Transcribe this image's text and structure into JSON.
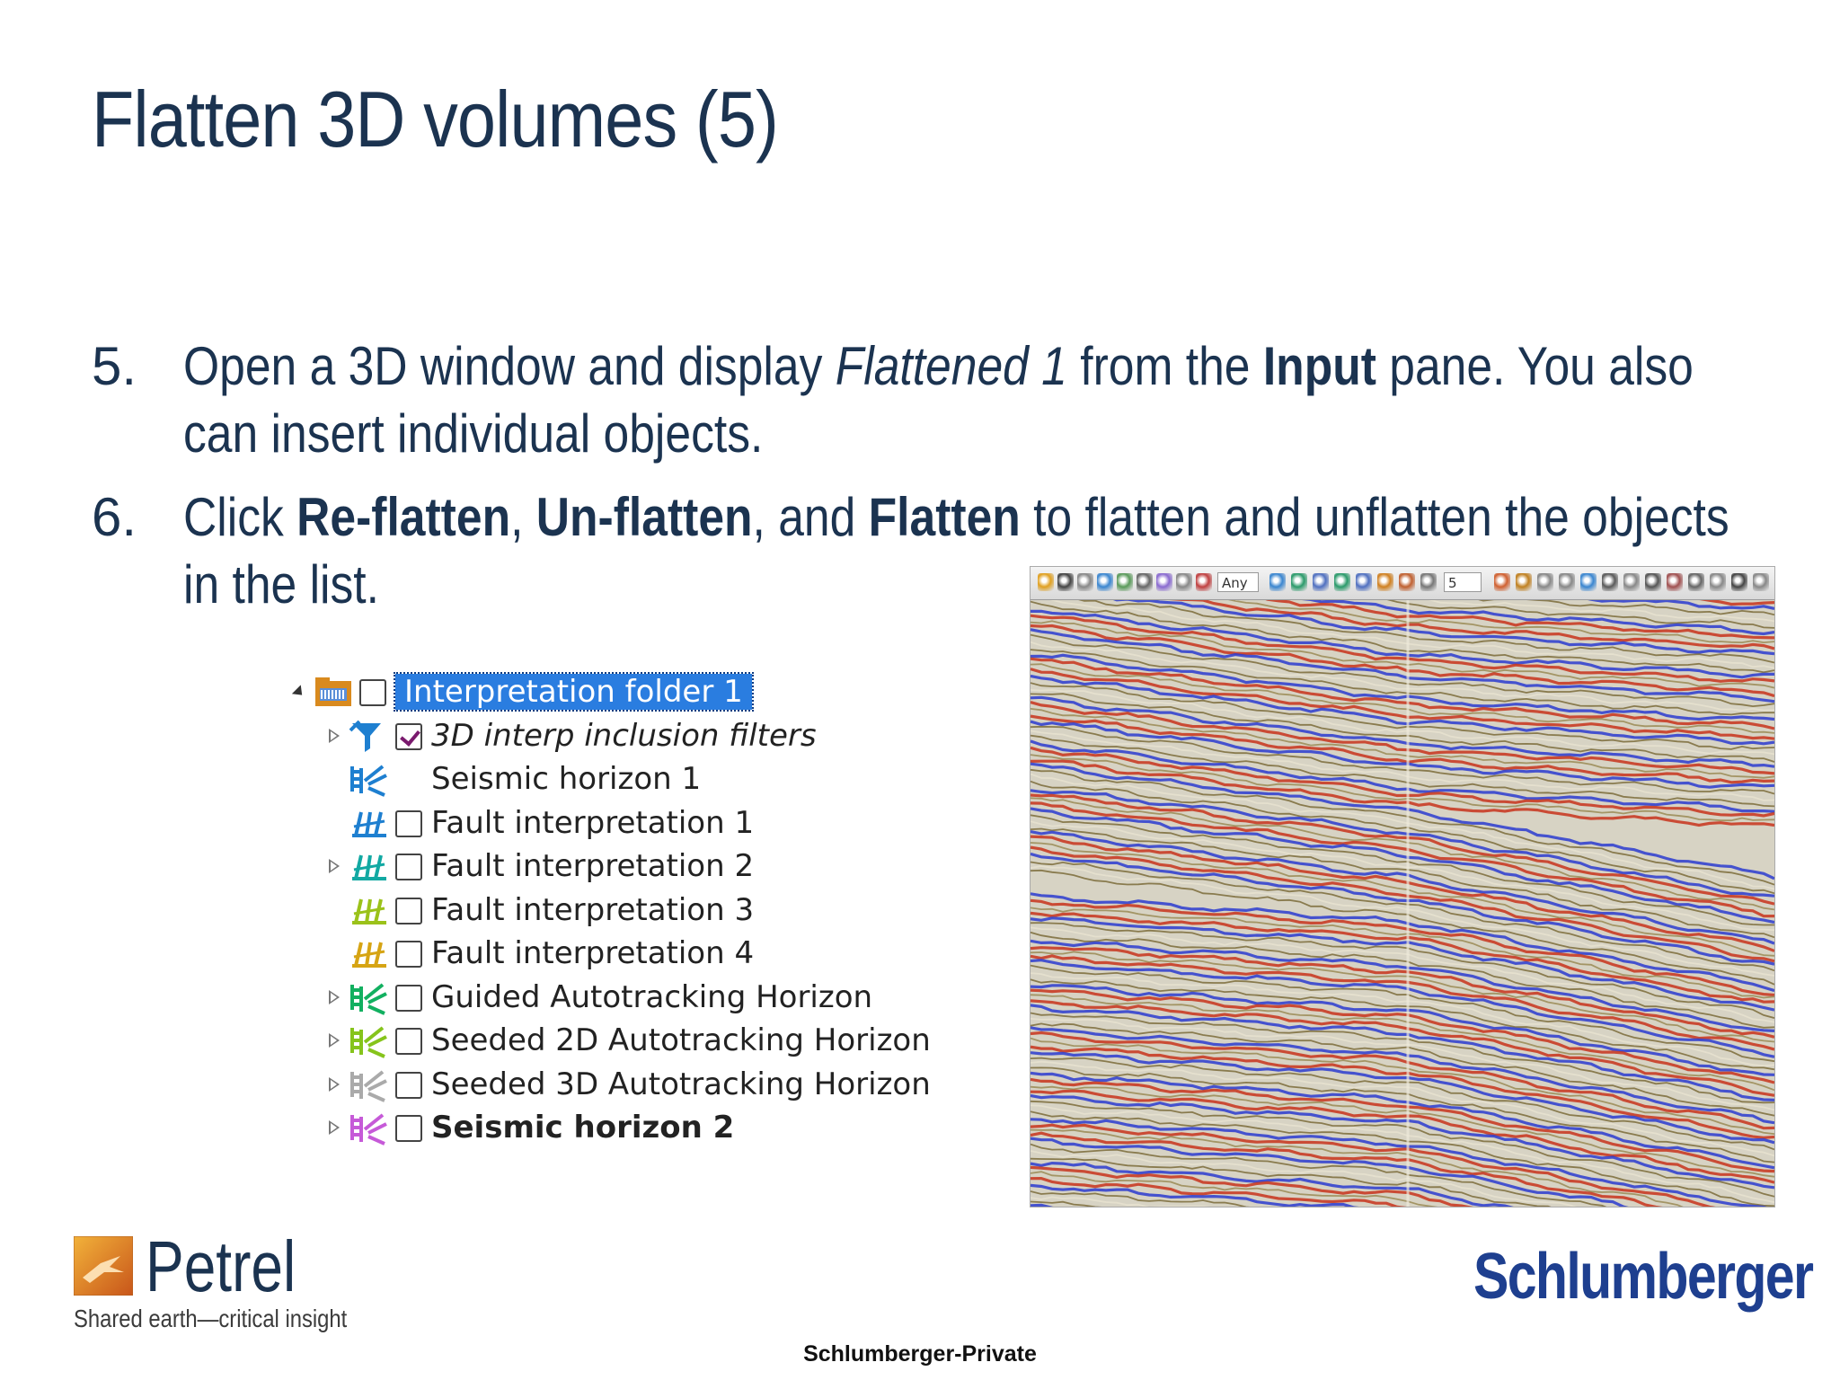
{
  "slide": {
    "title": "Flatten 3D volumes (5)"
  },
  "steps": [
    {
      "number": "5.",
      "parts": [
        "Open a 3D window and display ",
        "Flattened 1",
        " from the ",
        "Input",
        " pane. You also can insert individual objects."
      ]
    },
    {
      "number": "6.",
      "parts": [
        "Click ",
        "Re-flatten",
        ", ",
        "Un-flatten",
        ", and ",
        "Flatten",
        " to flatten and unflatten the objects in the list."
      ]
    }
  ],
  "tree": {
    "items": [
      {
        "label": "Interpretation folder 1",
        "icon": "folder-icon",
        "expander": "expanded",
        "checked": false,
        "selected": true,
        "style": "normal"
      },
      {
        "label": "3D interp inclusion filters",
        "icon": "filter-icon",
        "expander": "collapsed",
        "checked": true,
        "selected": false,
        "style": "italic"
      },
      {
        "label": "Seismic horizon 1",
        "icon": "horizon-icon",
        "expander": "none",
        "checked": null,
        "selected": false,
        "style": "normal"
      },
      {
        "label": "Fault interpretation 1",
        "icon": "fault-icon",
        "expander": "none",
        "checked": false,
        "selected": false,
        "style": "normal"
      },
      {
        "label": "Fault interpretation 2",
        "icon": "fault-icon",
        "expander": "collapsed",
        "checked": false,
        "selected": false,
        "style": "normal"
      },
      {
        "label": "Fault interpretation 3",
        "icon": "fault-icon",
        "expander": "none",
        "checked": false,
        "selected": false,
        "style": "normal"
      },
      {
        "label": "Fault interpretation 4",
        "icon": "fault-icon",
        "expander": "none",
        "checked": false,
        "selected": false,
        "style": "normal"
      },
      {
        "label": "Guided Autotracking Horizon",
        "icon": "horizon-icon",
        "expander": "collapsed",
        "checked": false,
        "selected": false,
        "style": "normal"
      },
      {
        "label": "Seeded 2D Autotracking Horizon",
        "icon": "horizon-icon",
        "expander": "collapsed",
        "checked": false,
        "selected": false,
        "style": "normal"
      },
      {
        "label": "Seeded 3D Autotracking Horizon",
        "icon": "horizon-icon",
        "expander": "collapsed",
        "checked": false,
        "selected": false,
        "style": "normal"
      },
      {
        "label": "Seismic horizon 2",
        "icon": "horizon-icon",
        "expander": "collapsed",
        "checked": false,
        "selected": false,
        "style": "bold"
      }
    ],
    "icon_colors": [
      "#d98a1e",
      "#1e7fd0",
      "#1e7fd0",
      "#1e7fd0",
      "#12a9a3",
      "#9bc21a",
      "#d6a414",
      "#12b060",
      "#86c41c",
      "#aaaaaa",
      "#c65ad8"
    ]
  },
  "seismic_window": {
    "toolbar": {
      "domain_value": "Any",
      "number_value": "5"
    },
    "palette": {
      "background": "#d7d3c4",
      "positive": "#c8321c",
      "negative": "#2b3bd0",
      "neutral": "#7b6b3a"
    }
  },
  "footer": {
    "product_name": "Petrel",
    "tagline": "Shared earth—critical insight",
    "company": "Schlumberger",
    "classification": "Schlumberger-Private"
  }
}
